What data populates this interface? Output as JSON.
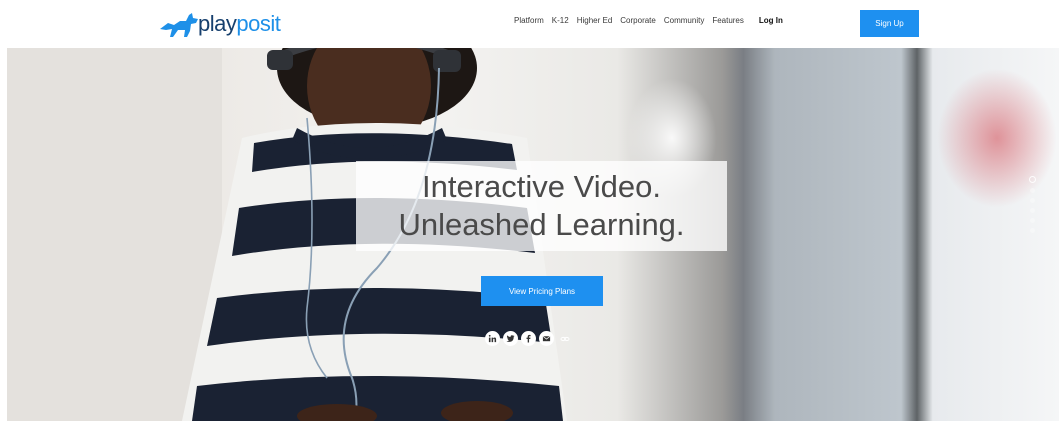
{
  "header": {
    "logo": {
      "text_main": "play",
      "text_accent": "posit",
      "icon": "dog-icon",
      "color_dark": "#17406e",
      "color_accent": "#1e90e8"
    },
    "nav": [
      {
        "label": "Platform"
      },
      {
        "label": "K-12"
      },
      {
        "label": "Higher Ed"
      },
      {
        "label": "Corporate"
      },
      {
        "label": "Community"
      },
      {
        "label": "Features"
      }
    ],
    "login_label": "Log In",
    "signup_label": "Sign Up",
    "accent_color": "#1e90f0"
  },
  "hero": {
    "headline_line1": "Interactive Video.",
    "headline_line2": "Unleashed Learning.",
    "cta_label": "View Pricing Plans",
    "socials": [
      {
        "icon": "linkedin-icon"
      },
      {
        "icon": "twitter-icon"
      },
      {
        "icon": "facebook-icon"
      },
      {
        "icon": "email-icon"
      },
      {
        "icon": "link-icon"
      }
    ],
    "slide_count": 6,
    "active_slide": 1
  }
}
